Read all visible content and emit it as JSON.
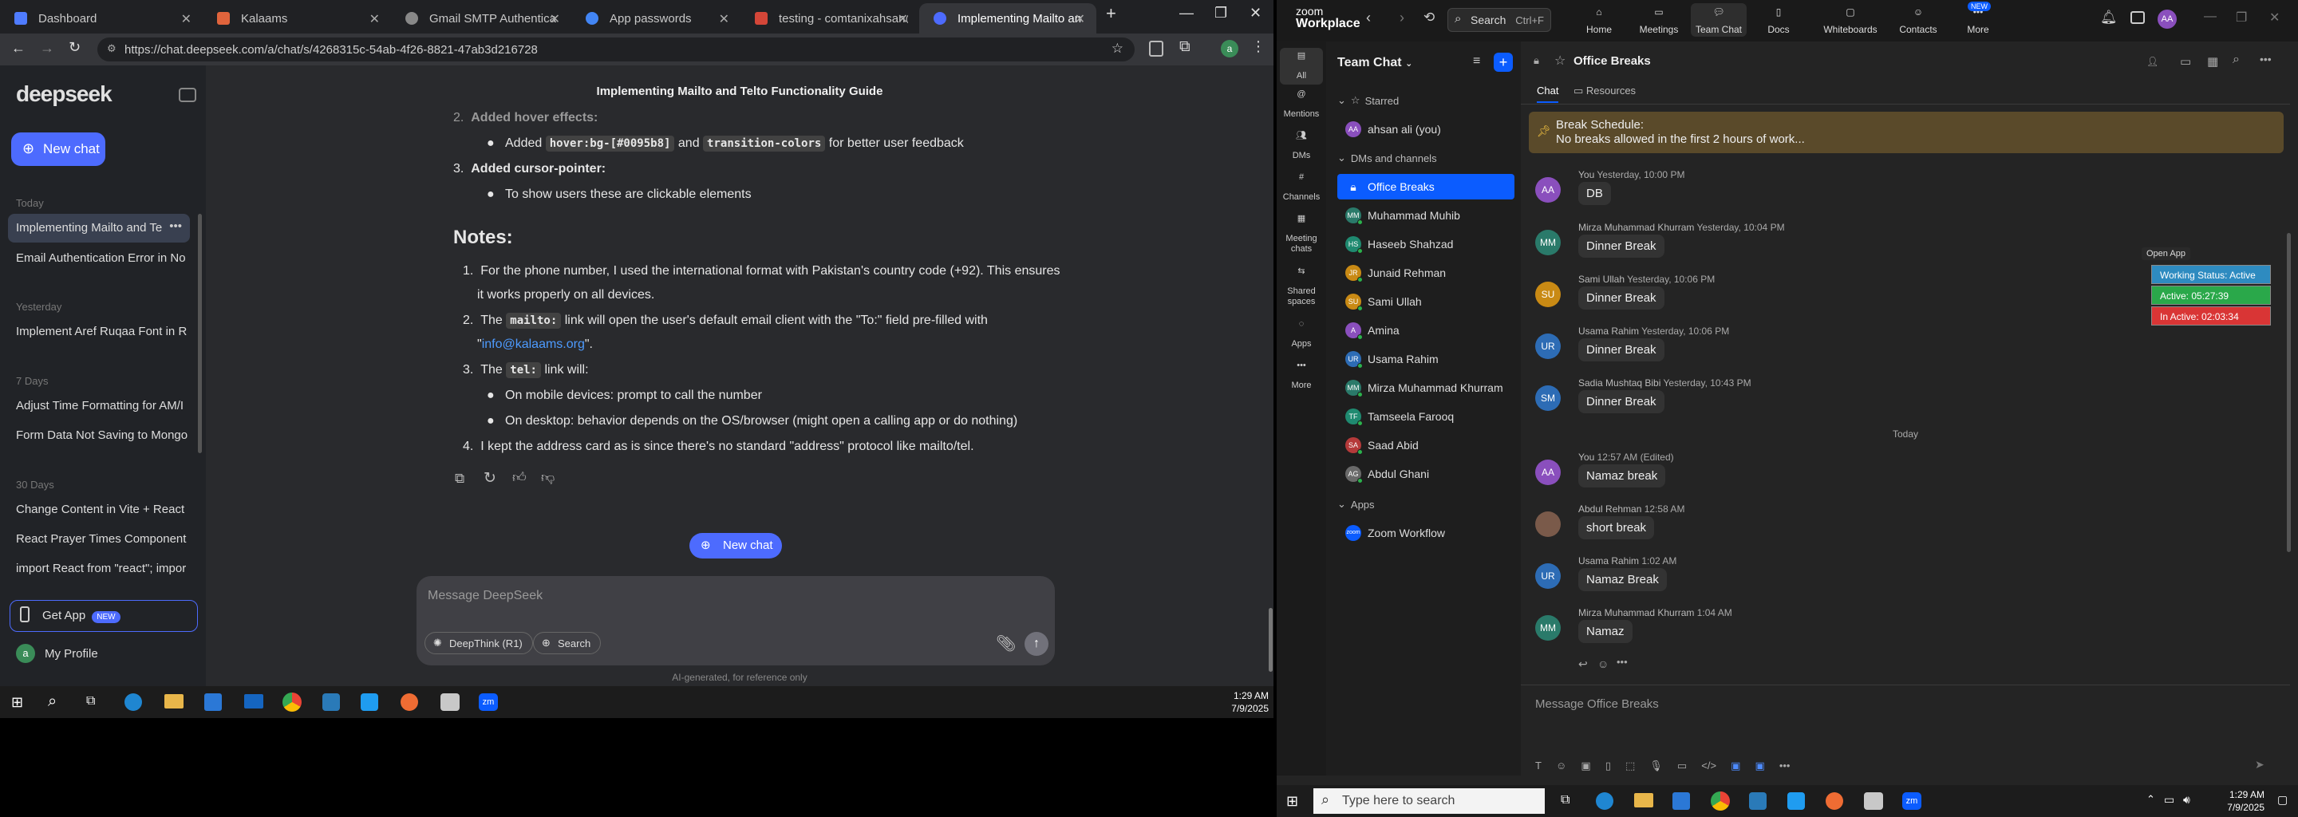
{
  "browser": {
    "tabs": [
      {
        "title": "Dashboard",
        "color": "#4f7cff"
      },
      {
        "title": "Kalaams",
        "color": "#e0643c"
      },
      {
        "title": "Gmail SMTP Authentication",
        "color": "#888888"
      },
      {
        "title": "App passwords",
        "color": "#4285f4"
      },
      {
        "title": "testing - comtanixahsan@g",
        "color": "#d44638"
      },
      {
        "title": "Implementing Mailto and Te",
        "color": "#4d6bfe"
      }
    ],
    "url": "https://chat.deepseek.com/a/chat/s/4268315c-54ab-4f26-8821-47ab3d216728"
  },
  "deepseek": {
    "logo": "deepseek",
    "new_chat": "New chat",
    "sections": {
      "today": "Today",
      "yesterday": "Yesterday",
      "days7": "7 Days",
      "days30": "30 Days"
    },
    "history": {
      "today": [
        "Implementing Mailto and Te"
      ],
      "today2": [
        "Email Authentication Error in No"
      ],
      "yesterday": [
        "Implement Aref Ruqaa Font in R"
      ],
      "days7": [
        "Adjust Time Formatting for AM/I",
        "Form Data Not Saving to Mongo"
      ],
      "days30": [
        "Change Content in Vite + React",
        "React Prayer Times Component F",
        "import React from \"react\"; impor"
      ]
    },
    "get_app": "Get App",
    "get_app_badge": "NEW",
    "profile": "My Profile",
    "profile_initial": "a",
    "chat_title": "Implementing Mailto and Telto Functionality Guide",
    "content": {
      "item2": "Added hover effects:",
      "item2_sub_pre": "Added",
      "item2_code1": "hover:bg-[#0095b8]",
      "item2_and": "and",
      "item2_code2": "transition-colors",
      "item2_post": "for better user feedback",
      "item3": "Added cursor-pointer:",
      "item3_sub": "To show users these are clickable elements",
      "notes_heading": "Notes:",
      "n1a": "For the phone number, I used the international format with Pakistan's country code (+92). This ensures",
      "n1b": "it works properly on all devices.",
      "n2_pre": "The",
      "n2_code": "mailto:",
      "n2_post": "link will open the user's default email client with the \"To:\" field pre-filled with",
      "n2_link": "info@kalaams.org",
      "n2_end": "\".",
      "n3_pre": "The",
      "n3_code": "tel:",
      "n3_post": "link will:",
      "n3_s1": "On mobile devices: prompt to call the number",
      "n3_s2": "On desktop: behavior depends on the OS/browser (might open a calling app or do nothing)",
      "n4": "I kept the address card as is since there's no standard \"address\" protocol like mailto/tel."
    },
    "new_chat_float": "New chat",
    "input_placeholder": "Message DeepSeek",
    "deepthink": "DeepThink (R1)",
    "search": "Search",
    "disclaimer": "AI-generated, for reference only"
  },
  "taskbar_left": {
    "time": "1:29 AM",
    "date": "7/9/2025"
  },
  "zoom": {
    "brand_top": "zoom",
    "brand_bottom": "Workplace",
    "search_label": "Search",
    "search_shortcut": "Ctrl+F",
    "nav": [
      "Home",
      "Meetings",
      "Team Chat",
      "Docs",
      "Whiteboards",
      "Contacts",
      "More"
    ],
    "more_badge": "NEW",
    "user_initials": "AA",
    "rail": [
      "All",
      "Mentions",
      "DMs",
      "Channels",
      "Meeting chats",
      "Shared spaces",
      "Apps",
      "More"
    ],
    "panel_title": "Team Chat",
    "starred_heading": "Starred",
    "starred": [
      {
        "name": "ahsan ali (you)",
        "initials": "AA",
        "color": "#8a4fbd"
      }
    ],
    "dm_heading": "DMs and channels",
    "dms": [
      {
        "name": "Office Breaks",
        "initials": "",
        "color": "#0b5cff",
        "selected": true
      },
      {
        "name": "Muhammad Muhib",
        "initials": "MM",
        "color": "#2a7a6a"
      },
      {
        "name": "Haseeb Shahzad",
        "initials": "HS",
        "color": "#1f8a70"
      },
      {
        "name": "Junaid Rehman",
        "initials": "JR",
        "color": "#c98a14"
      },
      {
        "name": "Sami Ullah",
        "initials": "SU",
        "color": "#c98a14"
      },
      {
        "name": "Amina",
        "initials": "A",
        "color": "#8a4fbd"
      },
      {
        "name": "Usama Rahim",
        "initials": "UR",
        "color": "#2d6cb5"
      },
      {
        "name": "Mirza Muhammad Khurram",
        "initials": "MM",
        "color": "#2a7a6a"
      },
      {
        "name": "Tamseela Farooq",
        "initials": "TF",
        "color": "#1f8a70"
      },
      {
        "name": "Saad Abid",
        "initials": "SA",
        "color": "#b53a3a"
      },
      {
        "name": "Abdul Ghani",
        "initials": "AG",
        "color": "#6a6a6a"
      }
    ],
    "apps_heading": "Apps",
    "apps": [
      {
        "name": "Zoom Workflow",
        "initials": "zoom",
        "color": "#0b5cff"
      }
    ],
    "channel_name": "Office Breaks",
    "tabs": [
      "Chat",
      "Resources"
    ],
    "banner_title": "Break Schedule:",
    "banner_text": "No breaks allowed in the first 2 hours of work...",
    "open_app": "Open App",
    "status": {
      "working": "Working Status: Active",
      "active": "Active: 05:27:39",
      "inactive": "In Active: 02:03:34",
      "working_color": "#2e8bc0",
      "active_color": "#2aa84a",
      "inactive_color": "#d93535"
    },
    "day_divider": "Today",
    "messages": [
      {
        "author": "You",
        "time": "Yesterday, 10:00 PM",
        "text": "DB",
        "initials": "AA",
        "color": "#8a4fbd"
      },
      {
        "author": "Mirza Muhammad Khurram",
        "time": "Yesterday, 10:04 PM",
        "text": "Dinner Break",
        "initials": "MM",
        "color": "#2a7a6a"
      },
      {
        "author": "Sami Ullah",
        "time": "Yesterday, 10:06 PM",
        "text": "Dinner Break",
        "initials": "SU",
        "color": "#c98a14"
      },
      {
        "author": "Usama Rahim",
        "time": "Yesterday, 10:06 PM",
        "text": "Dinner Break",
        "initials": "UR",
        "color": "#2d6cb5"
      },
      {
        "author": "Sadia Mushtaq Bibi",
        "time": "Yesterday, 10:43 PM",
        "text": "Dinner Break",
        "initials": "SM",
        "color": "#2d6cb5"
      },
      {
        "author": "You",
        "time": "12:57 AM (Edited)",
        "text": "Namaz break",
        "initials": "AA",
        "color": "#8a4fbd"
      },
      {
        "author": "Abdul Rehman",
        "time": "12:58 AM",
        "text": "short break",
        "initials": "",
        "color": "#7a5a4a"
      },
      {
        "author": "Usama Rahim",
        "time": "1:02 AM",
        "text": "Namaz Break",
        "initials": "UR",
        "color": "#2d6cb5"
      },
      {
        "author": "Mirza Muhammad Khurram",
        "time": "1:04 AM",
        "text": "Namaz",
        "initials": "MM",
        "color": "#2a7a6a"
      }
    ],
    "compose_placeholder": "Message Office Breaks"
  },
  "taskbar_right": {
    "search_placeholder": "Type here to search",
    "time": "1:29 AM",
    "date": "7/9/2025"
  }
}
